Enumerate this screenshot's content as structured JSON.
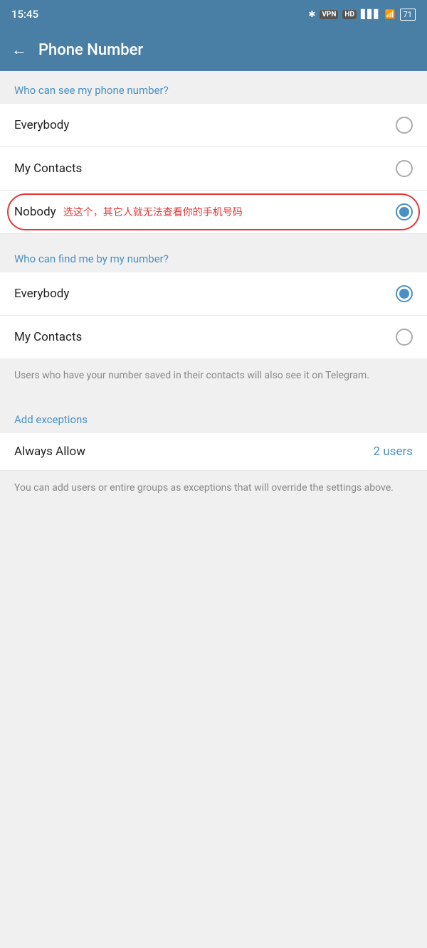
{
  "statusBar": {
    "time": "15:45",
    "icons": "🔵 VPN HD"
  },
  "header": {
    "backLabel": "←",
    "title": "Phone Number"
  },
  "section1": {
    "label": "Who can see my phone number?",
    "options": [
      {
        "id": "everybody1",
        "label": "Everybody",
        "selected": false
      },
      {
        "id": "mycontacts1",
        "label": "My Contacts",
        "selected": false
      },
      {
        "id": "nobody",
        "label": "Nobody",
        "annotation": "选这个，其它人就无法查看你的手机号码",
        "selected": true
      }
    ]
  },
  "section2": {
    "label": "Who can find me by my number?",
    "options": [
      {
        "id": "everybody2",
        "label": "Everybody",
        "selected": true
      },
      {
        "id": "mycontacts2",
        "label": "My Contacts",
        "selected": false
      }
    ],
    "infoText": "Users who have your number saved in their contacts will also see it on Telegram."
  },
  "section3": {
    "label": "Add exceptions",
    "rows": [
      {
        "id": "alwaysallow",
        "label": "Always Allow",
        "count": "2 users"
      }
    ],
    "infoText": "You can add users or entire groups as exceptions that will override the settings above."
  }
}
